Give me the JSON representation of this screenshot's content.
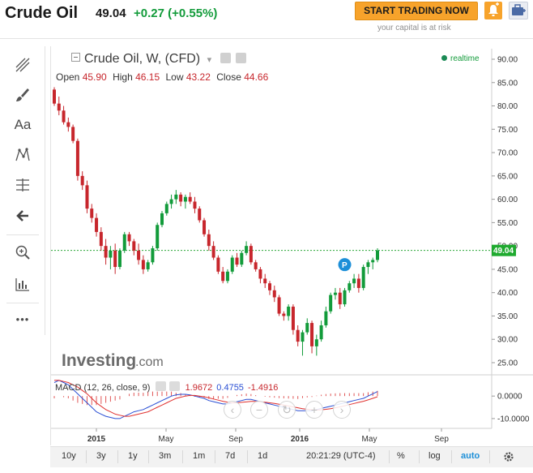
{
  "header": {
    "title": "Crude Oil",
    "price": "49.04",
    "change": "+0.27 (+0.55%)",
    "trade_button": "START TRADING NOW",
    "capital_note": "your capital is at risk",
    "alert_icon": "alert-plus-icon",
    "portfolio_icon": "portfolio-add-icon"
  },
  "toolbar": {
    "items": [
      "crosshair-lines-icon",
      "brush-icon",
      "text-icon",
      "pattern-icon",
      "fibonacci-icon",
      "arrow-left-icon",
      "zoom-in-icon",
      "indicator-bars-icon",
      "more-dots-icon"
    ],
    "text_tool_label": "Aa",
    "more_label": "•••"
  },
  "legend": {
    "title": "Crude Oil, W, (CFD)",
    "dropdown_glyph": "▾",
    "open_label": "Open",
    "open": "45.90",
    "high_label": "High",
    "high": "46.15",
    "low_label": "Low",
    "low": "43.22",
    "close_label": "Close",
    "close": "44.66",
    "realtime": "realtime"
  },
  "macd": {
    "label": "MACD (12, 26, close, 9)",
    "macd_value": "1.9672",
    "signal_value": "0.4755",
    "hist_value": "-1.4916",
    "axis_ticks": [
      "0.0000",
      "-10.0000"
    ]
  },
  "price_axis": {
    "ticks": [
      "90.00",
      "85.00",
      "80.00",
      "75.00",
      "70.00",
      "65.00",
      "60.00",
      "55.00",
      "50.00",
      "45.00",
      "40.00",
      "35.00",
      "30.00",
      "25.00"
    ],
    "current_label": "49.04"
  },
  "time_axis": {
    "labels": [
      "2015",
      "May",
      "Sep",
      "2016",
      "May",
      "Sep"
    ]
  },
  "zoom_controls": [
    "‹",
    "−",
    "↻",
    "+",
    "›"
  ],
  "bottom_bar": {
    "timeframes": [
      "10y",
      "3y",
      "1y",
      "3m",
      "1m",
      "7d",
      "1d"
    ],
    "clock": "20:21:29 (UTC-4)",
    "percent": "%",
    "log": "log",
    "auto": "auto",
    "settings_icon": "gear-icon"
  },
  "colors": {
    "up": "#129b3a",
    "down": "#c7262c",
    "macd_line": "#2a4fd4",
    "signal_line": "#e0312f",
    "accent": "#f7a32b"
  },
  "chart_data": {
    "type": "candlestick",
    "title": "Crude Oil, W, (CFD)",
    "ylim": [
      22,
      92
    ],
    "x_labels": [
      "2015",
      "May",
      "Sep",
      "2016",
      "May",
      "Sep"
    ],
    "last_price": 49.04,
    "marker": "P",
    "ohlc": [
      [
        83.5,
        84.0,
        80.0,
        80.5
      ],
      [
        80.5,
        82.0,
        78.0,
        79.0
      ],
      [
        79.0,
        80.0,
        76.0,
        76.5
      ],
      [
        76.5,
        77.5,
        74.5,
        75.5
      ],
      [
        75.5,
        76.0,
        72.0,
        72.5
      ],
      [
        72.5,
        73.0,
        64.0,
        65.0
      ],
      [
        65.0,
        66.0,
        62.0,
        63.0
      ],
      [
        63.0,
        64.0,
        57.0,
        58.0
      ],
      [
        58.0,
        59.0,
        55.0,
        56.0
      ],
      [
        56.0,
        57.0,
        52.0,
        53.0
      ],
      [
        53.0,
        54.0,
        49.0,
        50.0
      ],
      [
        50.0,
        51.5,
        46.0,
        47.5
      ],
      [
        47.5,
        50.0,
        45.0,
        49.0
      ],
      [
        49.0,
        50.5,
        44.0,
        45.5
      ],
      [
        45.5,
        49.5,
        45.0,
        49.0
      ],
      [
        49.0,
        53.0,
        48.5,
        52.5
      ],
      [
        52.5,
        53.0,
        50.0,
        51.0
      ],
      [
        51.0,
        51.5,
        48.0,
        49.0
      ],
      [
        49.0,
        50.5,
        46.0,
        47.0
      ],
      [
        47.0,
        48.0,
        44.0,
        45.0
      ],
      [
        45.0,
        47.0,
        44.5,
        46.5
      ],
      [
        46.5,
        50.0,
        46.0,
        49.5
      ],
      [
        49.5,
        55.0,
        49.0,
        54.5
      ],
      [
        54.5,
        57.5,
        54.0,
        57.0
      ],
      [
        57.0,
        59.5,
        56.5,
        59.0
      ],
      [
        59.0,
        61.0,
        58.0,
        60.0
      ],
      [
        60.0,
        62.0,
        59.0,
        61.0
      ],
      [
        61.0,
        61.5,
        58.5,
        59.5
      ],
      [
        59.5,
        61.0,
        58.0,
        60.5
      ],
      [
        60.5,
        61.5,
        59.0,
        59.5
      ],
      [
        59.5,
        60.5,
        57.0,
        58.0
      ],
      [
        58.0,
        58.5,
        55.0,
        55.5
      ],
      [
        55.5,
        56.0,
        52.0,
        52.5
      ],
      [
        52.5,
        53.5,
        49.0,
        50.0
      ],
      [
        50.0,
        51.0,
        47.0,
        47.5
      ],
      [
        47.5,
        48.0,
        44.0,
        44.5
      ],
      [
        44.5,
        45.5,
        42.0,
        42.5
      ],
      [
        42.5,
        45.0,
        42.0,
        44.5
      ],
      [
        44.5,
        48.0,
        44.0,
        47.5
      ],
      [
        47.5,
        48.5,
        45.5,
        46.0
      ],
      [
        46.0,
        49.0,
        45.5,
        48.5
      ],
      [
        48.5,
        51.0,
        48.0,
        50.0
      ],
      [
        50.0,
        50.5,
        46.0,
        46.5
      ],
      [
        46.5,
        47.0,
        44.5,
        45.0
      ],
      [
        45.0,
        45.5,
        42.0,
        43.0
      ],
      [
        43.0,
        44.0,
        41.0,
        42.0
      ],
      [
        42.0,
        42.5,
        39.5,
        40.5
      ],
      [
        40.5,
        41.5,
        38.0,
        39.0
      ],
      [
        39.0,
        39.5,
        35.0,
        35.5
      ],
      [
        35.5,
        36.0,
        34.0,
        35.0
      ],
      [
        35.0,
        37.5,
        34.0,
        37.0
      ],
      [
        37.0,
        37.5,
        31.0,
        32.0
      ],
      [
        32.0,
        33.0,
        28.5,
        29.5
      ],
      [
        29.5,
        32.0,
        26.5,
        31.5
      ],
      [
        31.5,
        34.5,
        31.0,
        33.5
      ],
      [
        33.5,
        34.0,
        27.0,
        28.5
      ],
      [
        28.5,
        31.0,
        26.5,
        30.0
      ],
      [
        30.0,
        34.0,
        29.5,
        33.0
      ],
      [
        33.0,
        37.0,
        32.5,
        36.0
      ],
      [
        36.0,
        40.0,
        35.5,
        39.5
      ],
      [
        39.5,
        41.0,
        38.5,
        40.0
      ],
      [
        40.0,
        41.0,
        36.5,
        37.5
      ],
      [
        37.5,
        41.0,
        37.0,
        40.5
      ],
      [
        40.5,
        42.5,
        40.0,
        42.0
      ],
      [
        42.0,
        44.0,
        41.0,
        43.0
      ],
      [
        43.0,
        44.0,
        40.0,
        41.0
      ],
      [
        41.0,
        46.0,
        40.5,
        45.5
      ],
      [
        45.5,
        47.0,
        44.0,
        46.5
      ],
      [
        46.5,
        47.5,
        45.0,
        47.0
      ],
      [
        47.0,
        49.5,
        46.5,
        49.04
      ]
    ],
    "macd_line": [
      6,
      7,
      6,
      5,
      3,
      1,
      -1,
      -3,
      -5,
      -7,
      -8,
      -9,
      -9.5,
      -10,
      -10,
      -9,
      -8,
      -7,
      -6.5,
      -6,
      -5,
      -4,
      -3,
      -2,
      -1,
      0,
      0.5,
      0.8,
      0.8,
      0.5,
      0,
      -0.5,
      -1,
      -2,
      -2.5,
      -3,
      -3.5,
      -3.5,
      -3,
      -2.5,
      -2,
      -1.5,
      -1.5,
      -2,
      -2.5,
      -3,
      -3.5,
      -4,
      -4.5,
      -5,
      -5.5,
      -6,
      -6.5,
      -6.5,
      -6.5,
      -6.5,
      -6,
      -5.5,
      -5,
      -4.5,
      -4,
      -3.5,
      -3,
      -2.5,
      -2,
      -1.5,
      -1,
      0,
      1,
      2
    ],
    "signal_line": [
      7,
      7,
      6.5,
      6,
      5,
      4,
      2.5,
      1,
      -1,
      -3,
      -4.5,
      -6,
      -7,
      -8,
      -8.5,
      -9,
      -9,
      -8.5,
      -8,
      -7.5,
      -7,
      -6,
      -5,
      -4,
      -3,
      -2,
      -1,
      -0.5,
      0,
      0.3,
      0.3,
      0,
      -0.3,
      -0.8,
      -1.3,
      -1.8,
      -2.3,
      -2.7,
      -3,
      -3,
      -2.8,
      -2.6,
      -2.4,
      -2.4,
      -2.5,
      -2.7,
      -3,
      -3.3,
      -3.6,
      -4,
      -4.4,
      -4.8,
      -5.2,
      -5.6,
      -5.9,
      -6.1,
      -6.2,
      -6.1,
      -5.9,
      -5.6,
      -5.2,
      -4.8,
      -4.3,
      -3.8,
      -3.3,
      -2.8,
      -2.3,
      -1.7,
      -1,
      -0.3
    ]
  }
}
